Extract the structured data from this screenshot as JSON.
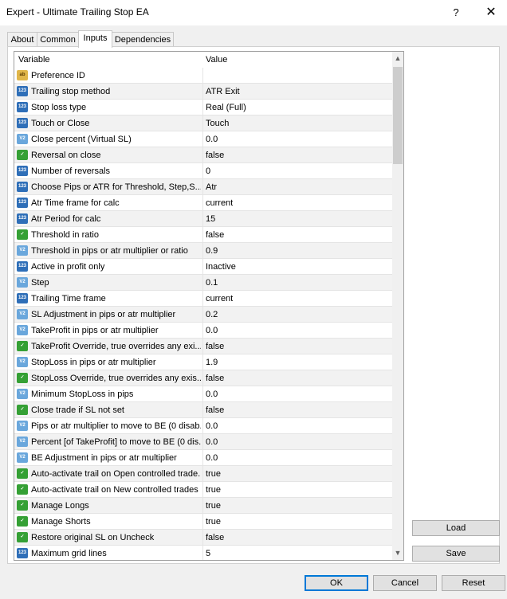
{
  "window": {
    "title": "Expert - Ultimate Trailing Stop EA",
    "help": "?",
    "close": "✕"
  },
  "tabs": [
    {
      "label": "About"
    },
    {
      "label": "Common"
    },
    {
      "label": "Inputs"
    },
    {
      "label": "Dependencies"
    }
  ],
  "active_tab": "Inputs",
  "grid": {
    "col_variable": "Variable",
    "col_value": "Value",
    "rows": [
      {
        "icon": "str",
        "icon_text": "ab",
        "name": "Preference ID",
        "value": ""
      },
      {
        "icon": "int",
        "icon_text": "123",
        "name": "Trailing stop method",
        "value": "ATR Exit"
      },
      {
        "icon": "int",
        "icon_text": "123",
        "name": "Stop loss type",
        "value": "Real (Full)"
      },
      {
        "icon": "int",
        "icon_text": "123",
        "name": "Touch or Close",
        "value": "Touch"
      },
      {
        "icon": "dbl",
        "icon_text": "V2",
        "name": "Close percent (Virtual SL)",
        "value": "0.0"
      },
      {
        "icon": "bool",
        "icon_text": "✓",
        "name": "Reversal on close",
        "value": "false"
      },
      {
        "icon": "int",
        "icon_text": "123",
        "name": "Number of reversals",
        "value": "0"
      },
      {
        "icon": "int",
        "icon_text": "123",
        "name": "Choose Pips or ATR for Threshold, Step,S...",
        "value": "Atr"
      },
      {
        "icon": "int",
        "icon_text": "123",
        "name": "Atr Time frame for calc",
        "value": "current"
      },
      {
        "icon": "int",
        "icon_text": "123",
        "name": "Atr Period for calc",
        "value": "15"
      },
      {
        "icon": "bool",
        "icon_text": "✓",
        "name": "Threshold in ratio",
        "value": "false"
      },
      {
        "icon": "dbl",
        "icon_text": "V2",
        "name": "Threshold in pips or atr multiplier or ratio",
        "value": "0.9"
      },
      {
        "icon": "int",
        "icon_text": "123",
        "name": "Active in profit only",
        "value": "Inactive"
      },
      {
        "icon": "dbl",
        "icon_text": "V2",
        "name": "Step",
        "value": "0.1"
      },
      {
        "icon": "int",
        "icon_text": "123",
        "name": "Trailing Time frame",
        "value": "current"
      },
      {
        "icon": "dbl",
        "icon_text": "V2",
        "name": "SL Adjustment in pips or atr multiplier",
        "value": "0.2"
      },
      {
        "icon": "dbl",
        "icon_text": "V2",
        "name": "TakeProfit in pips or atr multiplier",
        "value": "0.0"
      },
      {
        "icon": "bool",
        "icon_text": "✓",
        "name": "TakeProfit Override, true overrides any exi...",
        "value": "false"
      },
      {
        "icon": "dbl",
        "icon_text": "V2",
        "name": "StopLoss in pips or atr multiplier",
        "value": "1.9"
      },
      {
        "icon": "bool",
        "icon_text": "✓",
        "name": "StopLoss Override, true overrides any exis...",
        "value": "false"
      },
      {
        "icon": "dbl",
        "icon_text": "V2",
        "name": "Minimum StopLoss in pips",
        "value": "0.0"
      },
      {
        "icon": "bool",
        "icon_text": "✓",
        "name": "Close trade if SL not set",
        "value": "false"
      },
      {
        "icon": "dbl",
        "icon_text": "V2",
        "name": "Pips or atr multiplier to move to BE (0 disab...",
        "value": "0.0"
      },
      {
        "icon": "dbl",
        "icon_text": "V2",
        "name": "Percent [of TakeProfit] to move to BE (0 dis...",
        "value": "0.0"
      },
      {
        "icon": "dbl",
        "icon_text": "V2",
        "name": "BE Adjustment in pips or atr multiplier",
        "value": "0.0"
      },
      {
        "icon": "bool",
        "icon_text": "✓",
        "name": "Auto-activate trail on Open controlled trade...",
        "value": "true"
      },
      {
        "icon": "bool",
        "icon_text": "✓",
        "name": "Auto-activate trail on New controlled trades",
        "value": "true"
      },
      {
        "icon": "bool",
        "icon_text": "✓",
        "name": "Manage Longs",
        "value": "true"
      },
      {
        "icon": "bool",
        "icon_text": "✓",
        "name": "Manage Shorts",
        "value": "true"
      },
      {
        "icon": "bool",
        "icon_text": "✓",
        "name": "Restore original SL on Uncheck",
        "value": "false"
      },
      {
        "icon": "int",
        "icon_text": "123",
        "name": "Maximum grid lines",
        "value": "5"
      }
    ]
  },
  "buttons": {
    "load": "Load",
    "save": "Save",
    "ok": "OK",
    "cancel": "Cancel",
    "reset": "Reset"
  }
}
